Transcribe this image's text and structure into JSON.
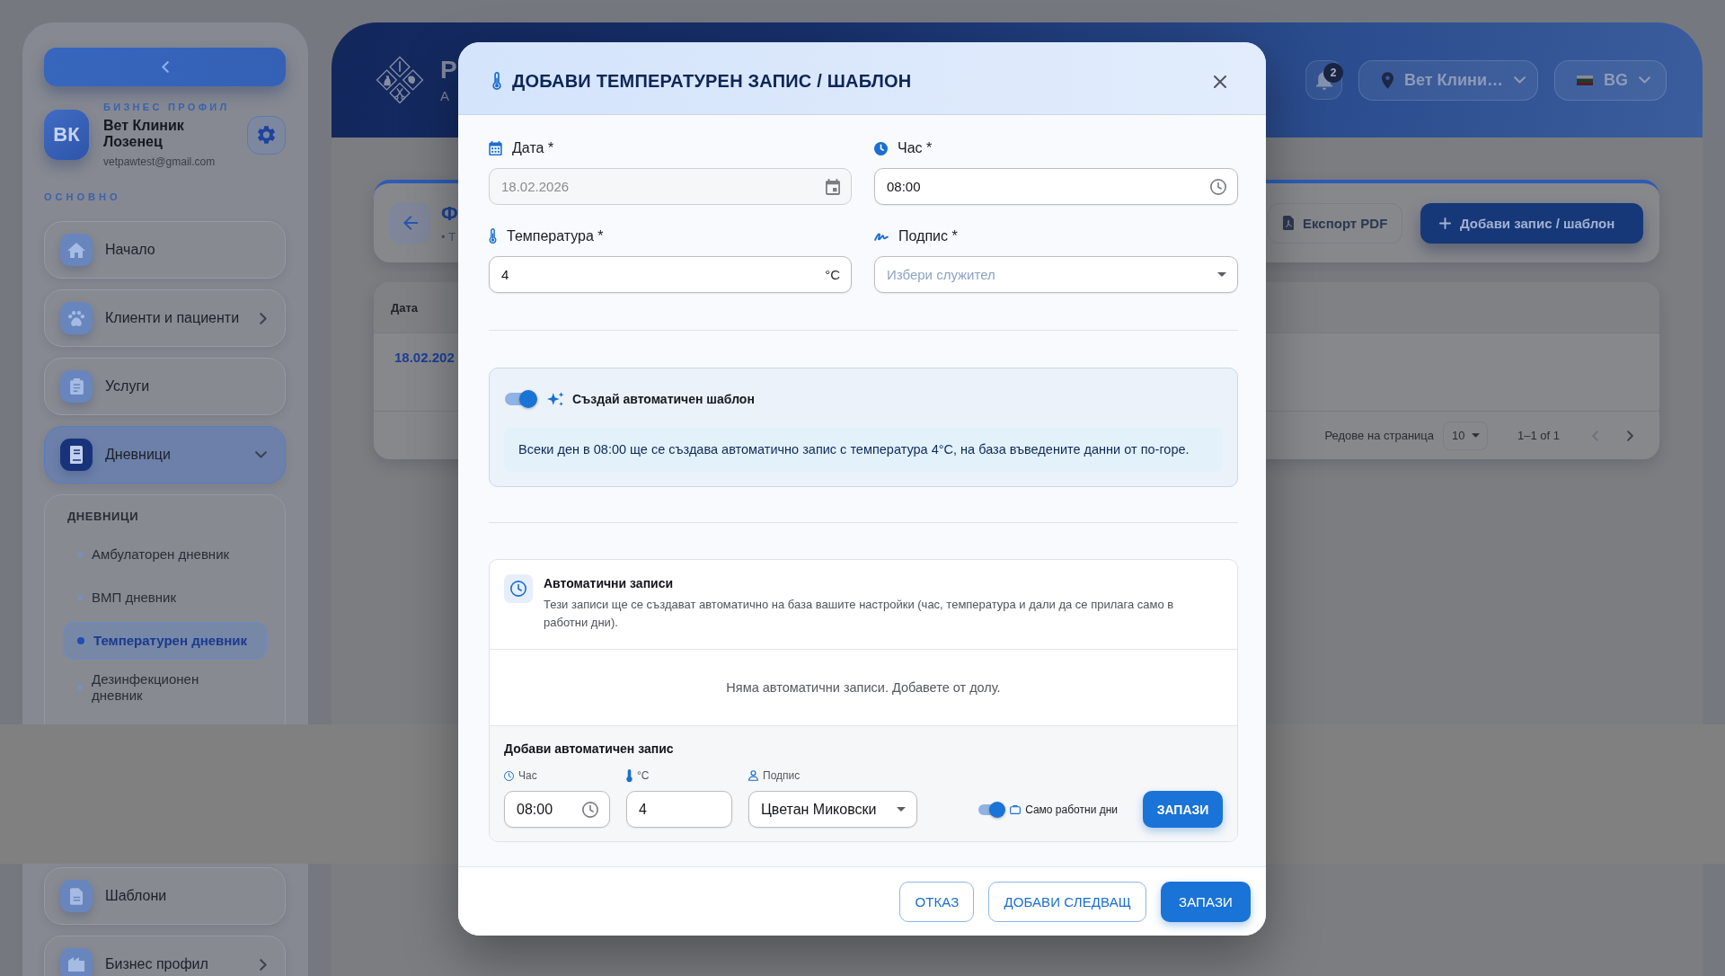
{
  "sidebar": {
    "profile": {
      "label": "БИЗНЕС ПРОФИЛ",
      "avatar": "ВК",
      "name": "Вет Клиник Лозенец",
      "email": "vetpawtest@gmail.com"
    },
    "section_label": "ОСНОВНО",
    "items": [
      {
        "label": "Начало",
        "kind": "link",
        "selected": false
      },
      {
        "label": "Клиенти и пациенти",
        "kind": "group",
        "expanded": false,
        "selected": false
      },
      {
        "label": "Услуги",
        "kind": "link",
        "selected": false
      },
      {
        "label": "Дневници",
        "kind": "group",
        "expanded": true,
        "selected": true,
        "submenu_title": "ДНЕВНИЦИ",
        "children": [
          {
            "label": "Амбулаторен дневник",
            "selected": false
          },
          {
            "label": "ВМП дневник",
            "selected": false
          },
          {
            "label": "Температурен дневник",
            "selected": true
          },
          {
            "label": "Дезинфекционен дневник",
            "selected": false
          }
        ]
      },
      {
        "label": "Шаблони",
        "kind": "link",
        "selected": false
      },
      {
        "label": "Бизнес профил",
        "kind": "group",
        "expanded": false,
        "selected": false
      }
    ]
  },
  "header": {
    "title": "P",
    "subtitle": "А",
    "notifications": "2",
    "location": "Вет Клини…",
    "language": "BG"
  },
  "page": {
    "title": "Ф",
    "subtitle": "• Т",
    "buttons": [
      {
        "label": "Експорт PDF",
        "kind": "outlined"
      },
      {
        "label": "Добави запис / шаблон",
        "kind": "primary"
      }
    ]
  },
  "table": {
    "columns": [
      "Дата"
    ],
    "rows": [
      [
        "18.02.202"
      ]
    ],
    "footer": {
      "rows_per_page_label": "Редове на страница",
      "rows_per_page": "10",
      "range": "1–1 of 1",
      "prev_disabled": true,
      "next_disabled": false
    }
  },
  "modal": {
    "title": "ДОБАВИ ТЕМПЕРАТУРЕН ЗАПИС / ШАБЛОН",
    "fields": [
      {
        "kind": "date",
        "label": "Дата *",
        "value": "18.02.2026",
        "disabled": true
      },
      {
        "kind": "time",
        "label": "Час *",
        "value": "08:00",
        "disabled": false
      },
      {
        "kind": "number",
        "label": "Температура *",
        "value": "4",
        "suffix": "°C",
        "disabled": false
      },
      {
        "kind": "select",
        "label": "Подпис *",
        "placeholder": "Избери служител",
        "disabled": false
      }
    ],
    "template": {
      "label": "Създай автоматичен шаблон",
      "on": true,
      "info": "Всеки ден в 08:00 ще се създава автоматично запис с температура 4°C, на база въведените данни от по-горе."
    },
    "auto_records": {
      "title": "Автоматични записи",
      "description": "Тези записи ще се създават автоматично на база вашите настройки (час, температура и дали да се прилага само в работни дни).",
      "empty": "Няма автоматични записи. Добавете от долу.",
      "add": {
        "title": "Добави автоматичен запис",
        "fields": [
          {
            "kind": "time",
            "label": "Час",
            "value": "08:00"
          },
          {
            "kind": "number",
            "label": "°C",
            "value": "4"
          },
          {
            "kind": "select",
            "label": "Подпис",
            "value": "Цветан Миковски"
          }
        ],
        "workdays": {
          "label": "Само работни дни",
          "on": true
        },
        "button": "ЗАПАЗИ"
      }
    },
    "buttons": [
      {
        "label": "ОТКАЗ",
        "kind": "outlined"
      },
      {
        "label": "ДОБАВИ СЛЕДВАЩ",
        "kind": "outlined"
      },
      {
        "label": "ЗАПАЗИ",
        "kind": "primary"
      }
    ]
  }
}
